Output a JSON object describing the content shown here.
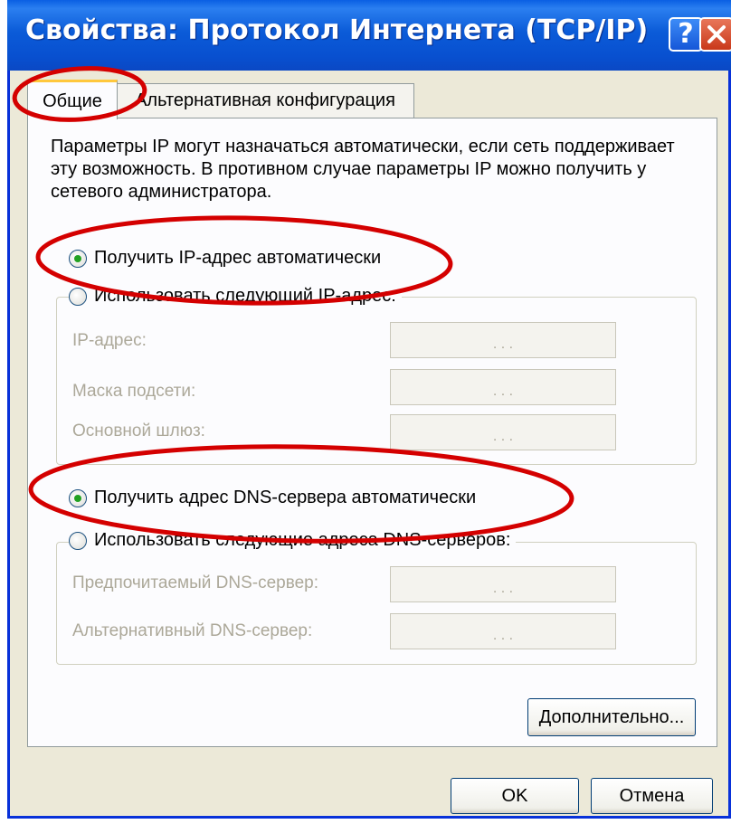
{
  "window": {
    "title": "Свойства: Протокол Интернета (TCP/IP)",
    "help_glyph": "?",
    "accent_color": "#0a5fe3",
    "close_color": "#c9381a"
  },
  "tabs": [
    {
      "label": "Общие",
      "selected": true
    },
    {
      "label": "Альтернативная конфигурация",
      "selected": false
    }
  ],
  "description": "Параметры IP могут назначаться автоматически, если сеть поддерживает эту возможность. В противном случае параметры IP можно получить у сетевого администратора.",
  "ip_section": {
    "auto_label": "Получить IP-адрес автоматически",
    "auto_selected": true,
    "manual_label": "Использовать следующий IP-адрес:",
    "fields": [
      {
        "label": "IP-адрес:",
        "value": ". . ."
      },
      {
        "label": "Маска подсети:",
        "value": ". . ."
      },
      {
        "label": "Основной шлюз:",
        "value": ". . ."
      }
    ]
  },
  "dns_section": {
    "auto_label": "Получить адрес DNS-сервера автоматически",
    "auto_selected": true,
    "manual_label": "Использовать следующие адреса DNS-серверов:",
    "fields": [
      {
        "label": "Предпочитаемый DNS-сервер:",
        "value": ". . ."
      },
      {
        "label": "Альтернативный DNS-сервер:",
        "value": ". . ."
      }
    ]
  },
  "buttons": {
    "advanced": "Дополнительно...",
    "ok": "OK",
    "cancel": "Отмена"
  },
  "annotation_color": "#d40000"
}
